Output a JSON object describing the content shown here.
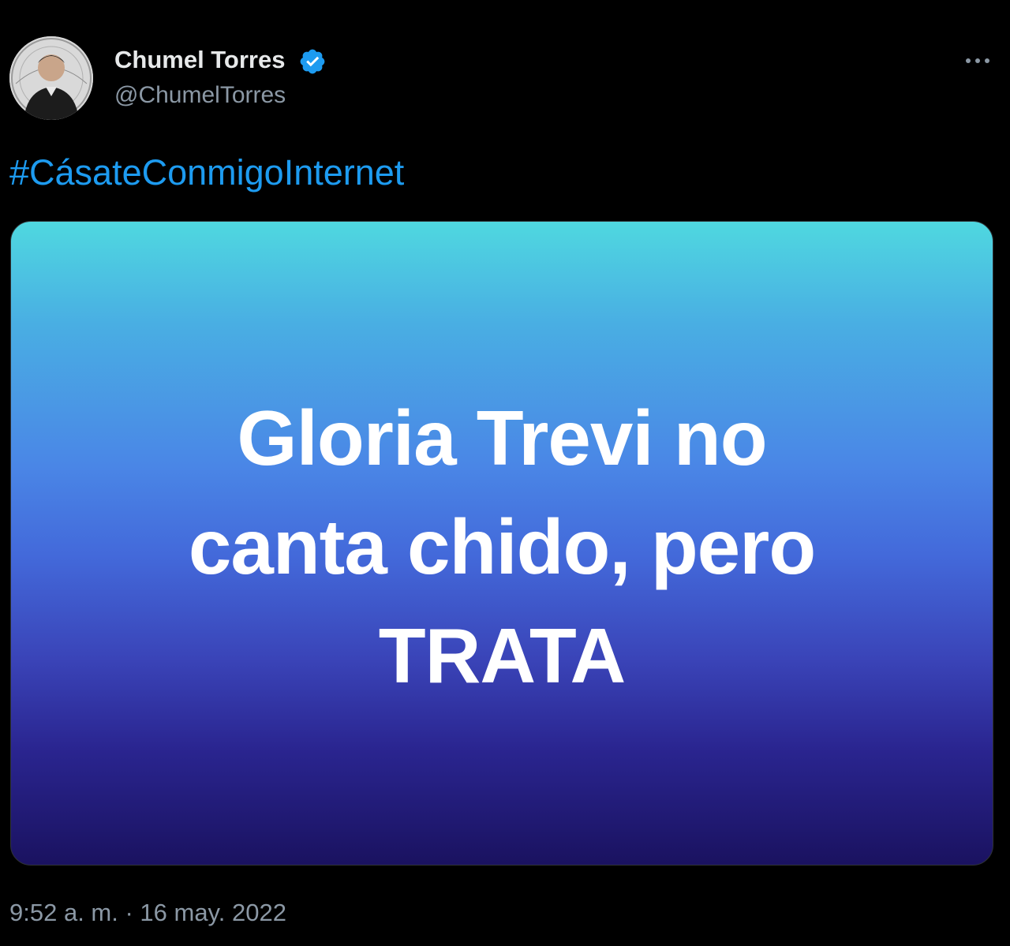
{
  "tweet": {
    "author": {
      "name": "Chumel Torres",
      "handle": "@ChumelTorres",
      "verified": true,
      "avatar_icon": "profile-photo"
    },
    "more_icon": "more-horizontal-icon",
    "text": "#CásateConmigoInternet",
    "media": {
      "lines": [
        "Gloria Trevi no",
        "canta chido, pero",
        "TRATA"
      ]
    },
    "timestamp": "9:52 a. m. · 16 may. 2022"
  },
  "colors": {
    "background": "#000000",
    "name": "#e7e9ea",
    "secondary": "#8b98a5",
    "link": "#1d9bf0",
    "verified_badge": "#1d9bf0",
    "media_gradient_top": "#4fd8e0",
    "media_gradient_mid": "#4369da",
    "media_gradient_bottom": "#1a1260"
  }
}
